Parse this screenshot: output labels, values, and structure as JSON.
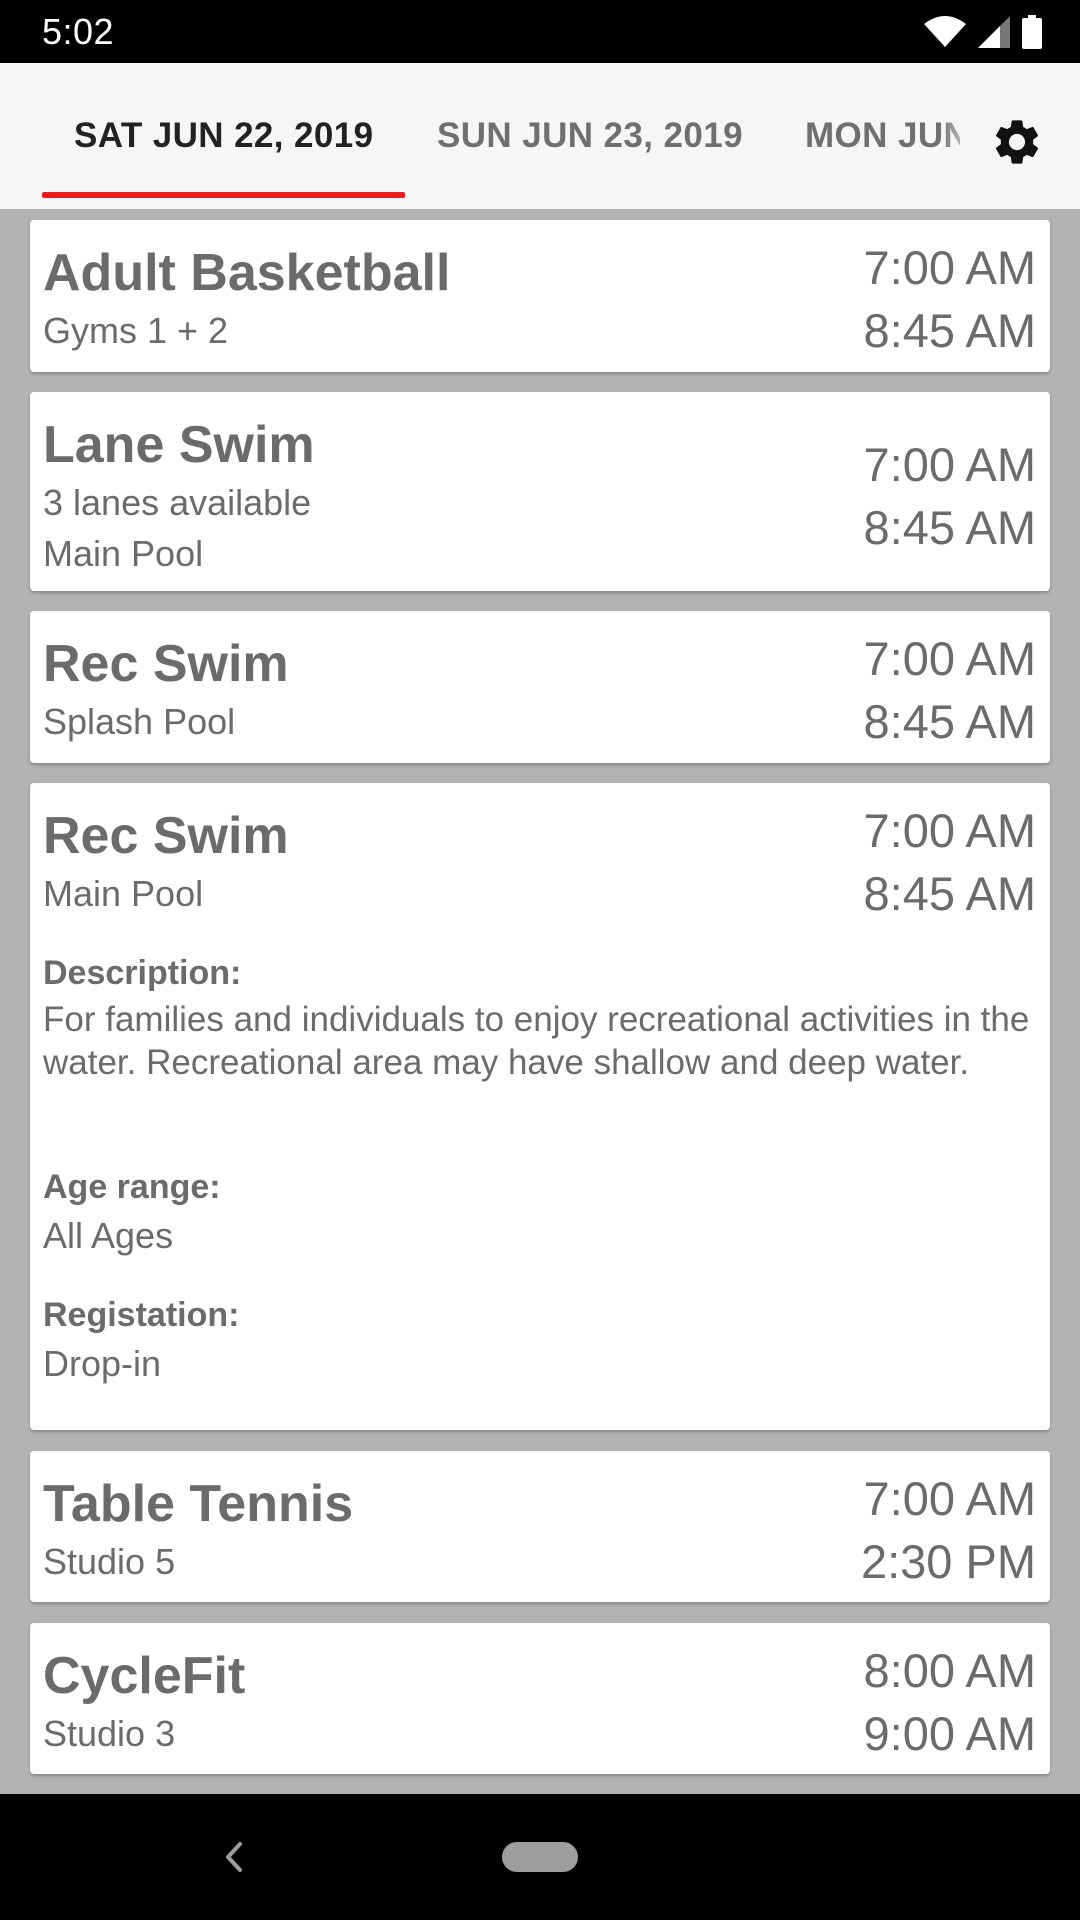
{
  "status_bar": {
    "time": "5:02"
  },
  "tabs": [
    {
      "label": "SAT JUN 22, 2019",
      "selected": true
    },
    {
      "label": "SUN JUN 23, 2019",
      "selected": false
    },
    {
      "label": "MON JUN",
      "selected": false
    }
  ],
  "colors": {
    "accent": "#ee1c1c",
    "text": "#6b6b6b",
    "background": "#b3b3b3"
  },
  "icons": {
    "settings": "gear-icon",
    "back": "back-arrow-icon",
    "home": "home-pill-icon"
  },
  "events": [
    {
      "title": "Adult Basketball",
      "location": "Gyms 1 + 2",
      "start": "7:00 AM",
      "end": "8:45 AM"
    },
    {
      "title": "Lane Swim",
      "detail": "3 lanes available",
      "location": "Main Pool",
      "start": "7:00 AM",
      "end": "8:45 AM"
    },
    {
      "title": "Rec Swim",
      "location": "Splash Pool",
      "start": "7:00 AM",
      "end": "8:45 AM"
    },
    {
      "title": "Rec Swim",
      "location": "Main Pool",
      "start": "7:00 AM",
      "end": "8:45 AM",
      "description_label": "Description:",
      "description": "For families and individuals to enjoy recreational activities in the water. Recreational area may have shallow and deep water.",
      "age_label": "Age range:",
      "age": "All Ages",
      "registration_label": "Registation:",
      "registration": "Drop-in"
    },
    {
      "title": "Table Tennis",
      "location": "Studio 5",
      "start": "7:00 AM",
      "end": "2:30 PM"
    },
    {
      "title": "CycleFit",
      "location": "Studio 3",
      "start": "8:00 AM",
      "end": "9:00 AM"
    }
  ]
}
